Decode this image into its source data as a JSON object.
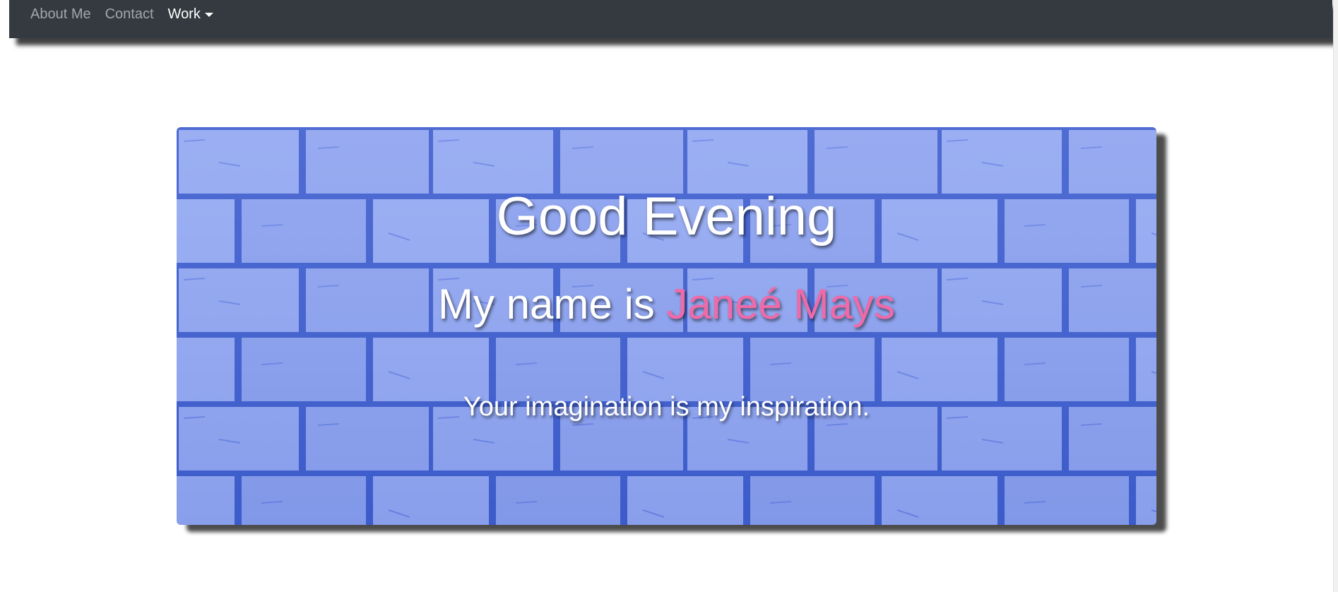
{
  "nav": {
    "items": [
      {
        "label": "About Me"
      },
      {
        "label": "Contact"
      },
      {
        "label": "Work"
      }
    ]
  },
  "hero": {
    "greeting": "Good Evening",
    "intro_prefix": "My name is ",
    "name": "Janeé Mays",
    "tagline": "Your imagination is my inspiration."
  },
  "colors": {
    "navbar": "#343a40",
    "name_accent": "#f06aa8",
    "wall": "#8ea4f0"
  },
  "icons": {
    "dropdown": "caret-down-icon"
  }
}
